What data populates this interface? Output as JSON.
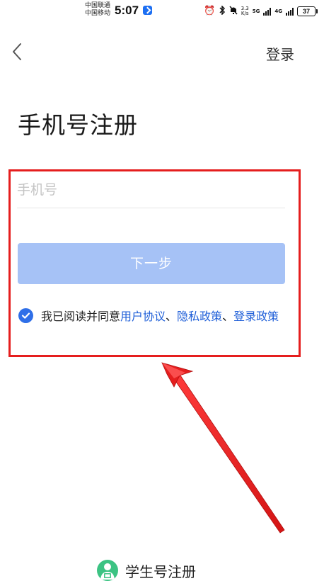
{
  "status_bar": {
    "carrier_1": "中国联通",
    "carrier_2": "中国移动",
    "time": "5:07",
    "speed_value": "3.3",
    "speed_unit": "K/s",
    "network_1": "5G",
    "network_2": "4G",
    "battery": "37",
    "icons": [
      "alarm-icon",
      "bluetooth-icon",
      "mute-icon",
      "signal-icon",
      "battery-icon"
    ]
  },
  "header": {
    "back_icon": "chevron-left-icon",
    "login_label": "登录"
  },
  "title": "手机号注册",
  "form": {
    "phone_placeholder": "手机号",
    "phone_value": "",
    "next_label": "下一步",
    "next_color": "#a6c2f6"
  },
  "agreement": {
    "checked": true,
    "prefix": "我已阅读并同意",
    "user_agreement": "用户协议",
    "sep_1": "、",
    "privacy_policy": "隐私政策",
    "sep_2": "、",
    "login_policy": "登录政策",
    "link_color": "#1f5fd8"
  },
  "footer": {
    "student_register_label": "学生号注册",
    "icon": "student-icon",
    "icon_color": "#3cc383"
  },
  "annotation": {
    "color": "#e51e1e"
  }
}
